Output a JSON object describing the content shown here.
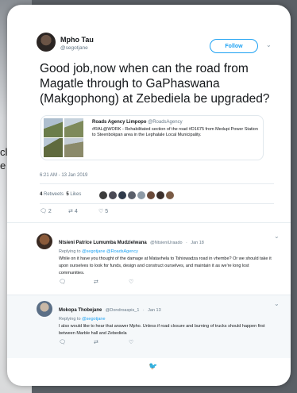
{
  "background": {
    "side_text": "cl\ne"
  },
  "tweet": {
    "author": "Mpho Tau",
    "handle": "@segotjane",
    "follow_label": "Follow",
    "text": "Good job,now when can the road from Magatle through to GaPhaswana (Makgophong) at Zebediela be upgraded?",
    "quoted": {
      "account": "Roads Agency Limpopo",
      "account_handle": "@RoadsAgency",
      "text": "#RAL@WORK - Rehabilitated section of the road #D1675 from Medupi Power Station to Steenbokpan area in the Lephalale Local Municipality."
    },
    "timestamp": "6:21 AM - 13 Jan 2019",
    "retweets_count": "4",
    "retweets_label": "Retweets",
    "likes_count": "5",
    "likes_label": "Likes",
    "reply_count": "2",
    "retweet_count": "4",
    "like_count": "5"
  },
  "replies": [
    {
      "name": "Ntsieni Patrice Lumumba Mudzielwana",
      "handle": "@NtsieniUraado",
      "date": "Jan 18",
      "replying_label": "Replying to",
      "replying_to": "@segotjane @RoadsAgency",
      "text": "While on it have you thought of the damage at Matavhela to Tshixwadza road in vhembe? Or we should take it upon ourselves to look for funds, design and construct ourselves, and maintain it as we're long lost communities."
    },
    {
      "name": "Mokopa Thobejane",
      "handle": "@Dondroaspis_1",
      "date": "Jan 13",
      "replying_label": "Replying to",
      "replying_to": "@segotjane",
      "text": "I also would like to hear that answer Mpho. Unless if road closure and burning of trucks should happen first between Marble hall and Zebediela"
    }
  ],
  "colors": {
    "accent": "#1da1f2",
    "text": "#14171a",
    "muted": "#657786"
  }
}
